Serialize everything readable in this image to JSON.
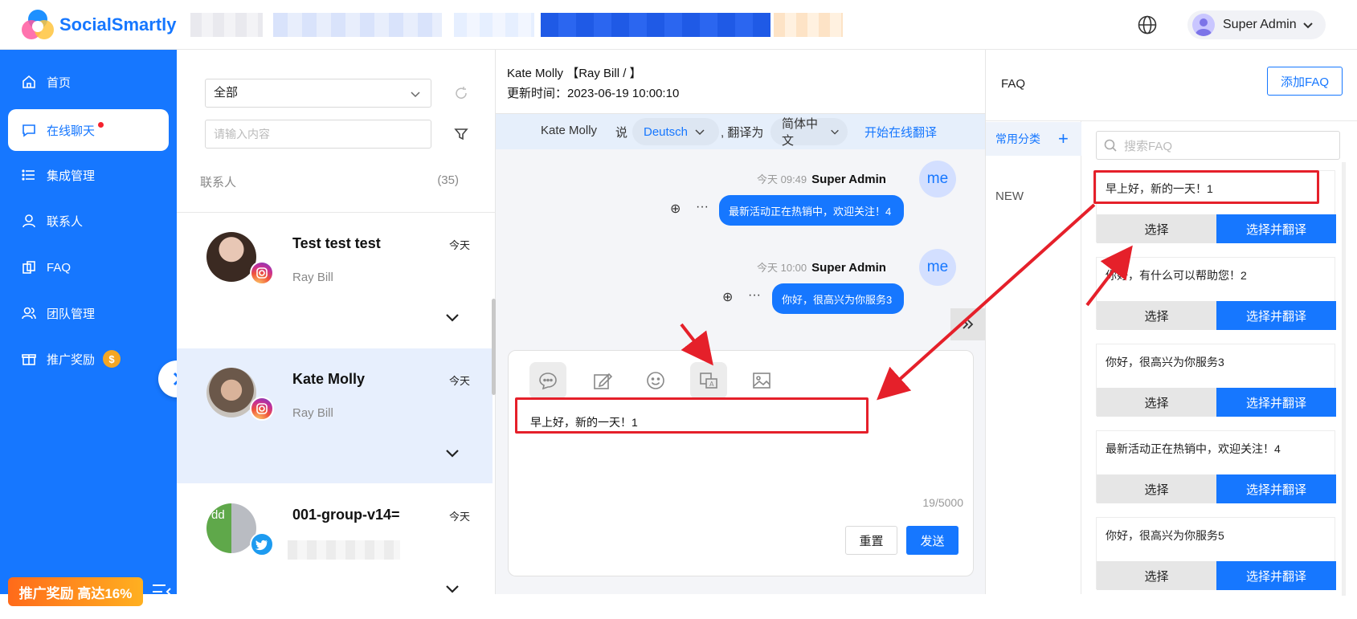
{
  "topbar": {
    "app_name": "SocialSmartly",
    "user_name": "Super Admin"
  },
  "sidebar": {
    "items": [
      {
        "label": "首页",
        "icon": "home-icon"
      },
      {
        "label": "在线聊天",
        "icon": "chat-icon"
      },
      {
        "label": "集成管理",
        "icon": "list-icon"
      },
      {
        "label": "联系人",
        "icon": "person-icon"
      },
      {
        "label": "FAQ",
        "icon": "faq-icon"
      },
      {
        "label": "团队管理",
        "icon": "team-icon"
      },
      {
        "label": "推广奖励",
        "icon": "gift-icon"
      }
    ],
    "coin_symbol": "$",
    "promo_label": "推广奖励 高达16%"
  },
  "contacts": {
    "filter_value": "全部",
    "search_placeholder": "请输入内容",
    "section_label": "联系人",
    "count": "(35)",
    "list": [
      {
        "name": "Test test test",
        "subtitle": "Ray Bill",
        "time": "今天"
      },
      {
        "name": "Kate Molly",
        "subtitle": "Ray Bill",
        "time": "今天"
      },
      {
        "name": "001-group-v14=",
        "subtitle": "",
        "time": "今天"
      }
    ]
  },
  "chat": {
    "header_line1": "Kate Molly 【Ray Bill / 】",
    "header_line2": "更新时间：2023-06-19 10:00:10",
    "translate": {
      "speaker": "Kate Molly",
      "says": "说",
      "source_lang": "Deutsch",
      "translate_to": ", 翻译为",
      "target_lang": "简体中文",
      "action": "开始在线翻译"
    },
    "messages": [
      {
        "time": "今天 09:49",
        "sender": "Super Admin",
        "text": "最新活动正在热销中，欢迎关注！4",
        "avatar": "me"
      },
      {
        "time": "今天 10:00",
        "sender": "Super Admin",
        "text": "你好，很高兴为你服务3",
        "avatar": "me"
      }
    ],
    "composer": {
      "text": "早上好，新的一天！1",
      "counter": "19/5000",
      "reset_label": "重置",
      "send_label": "发送"
    }
  },
  "faq": {
    "title": "FAQ",
    "add_label": "添加FAQ",
    "category_header": "常用分类",
    "categories": [
      "NEW"
    ],
    "search_placeholder": "搜索FAQ",
    "select_label": "选择",
    "select_translate_label": "选择并翻译",
    "items": [
      "早上好，新的一天！1",
      "你好，有什么可以帮助您！2",
      "你好，很高兴为你服务3",
      "最新活动正在热销中，欢迎关注！4",
      "你好，很高兴为你服务5"
    ]
  },
  "colors": {
    "primary": "#1677ff",
    "annotation": "#e5202a",
    "promo": "#ff8a1a"
  }
}
